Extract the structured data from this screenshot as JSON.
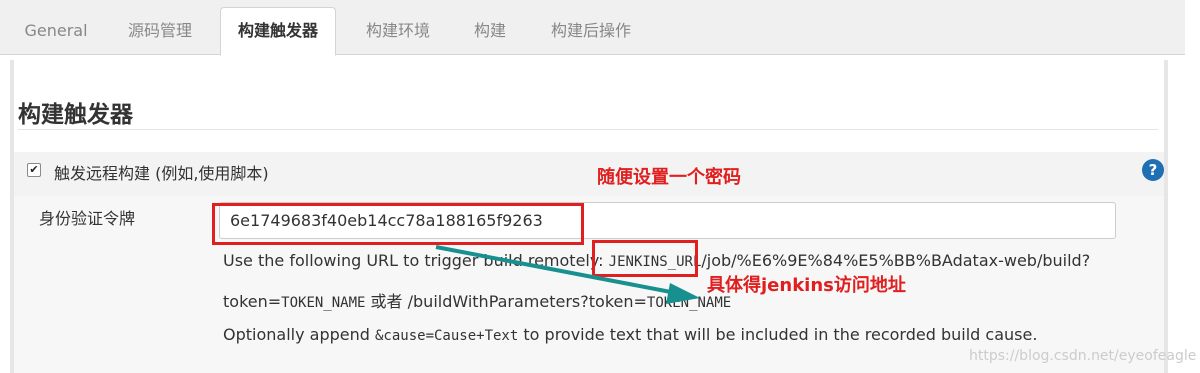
{
  "tabs": [
    {
      "label": "General"
    },
    {
      "label": "源码管理"
    },
    {
      "label": "构建触发器"
    },
    {
      "label": "构建环境"
    },
    {
      "label": "构建"
    },
    {
      "label": "构建后操作"
    }
  ],
  "section": {
    "title": "构建触发器"
  },
  "trigger": {
    "checkbox_label": "触发远程构建 (例如,使用脚本)",
    "checked": true,
    "help_label": "?"
  },
  "token_field": {
    "label": "身份验证令牌",
    "value": "6e1749683f40eb14cc78a188165f9263"
  },
  "help": {
    "line1_prefix": "Use the following URL to trigger build remotely: ",
    "line1_code": "JENKINS_URL",
    "line1_suffix": "/job/%E6%9E%84%E5%BB%BAdatax-web/build?",
    "line2_prefix": "token=",
    "line2_code1": "TOKEN_NAME",
    "line2_middle": " 或者 /buildWithParameters?token=",
    "line2_code2": "TOKEN_NAME",
    "line3_prefix": "Optionally append ",
    "line3_code": "&cause=Cause+Text",
    "line3_suffix": " to provide text that will be included in the recorded build cause."
  },
  "annotations": {
    "token_note": "随便设置一个密码",
    "url_note": "具体得jenkins访问地址",
    "color": "#e02020",
    "arrow_color": "#17908f"
  },
  "watermark": "https://blog.csdn.net/eyeofeagle"
}
